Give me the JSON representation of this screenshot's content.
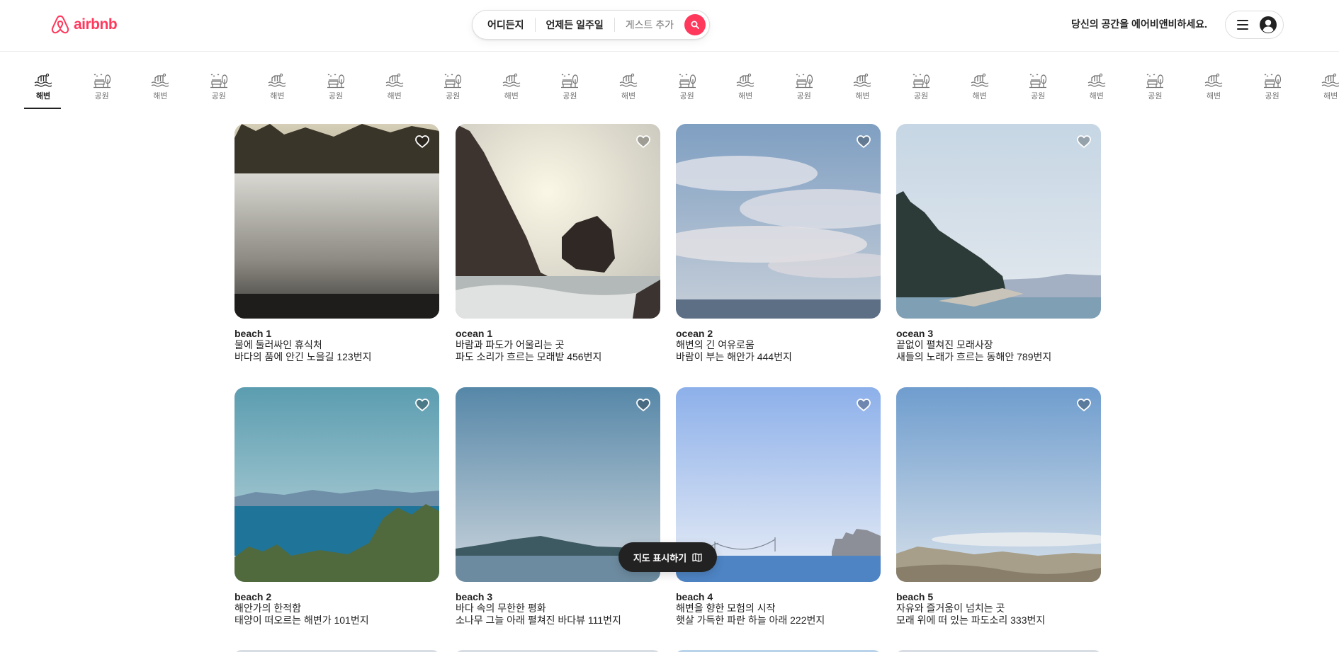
{
  "header": {
    "logo_text": "airbnb",
    "search": {
      "where": "어디든지",
      "when": "언제든 일주일",
      "guests": "게스트 추가"
    },
    "host_link": "당신의 공간을 에어비앤비하세요."
  },
  "categories": [
    {
      "label": "해변",
      "icon": "beach-icon",
      "active": true
    },
    {
      "label": "공원",
      "icon": "park-icon"
    },
    {
      "label": "해변",
      "icon": "beach-icon"
    },
    {
      "label": "공원",
      "icon": "park-icon"
    },
    {
      "label": "해변",
      "icon": "beach-icon"
    },
    {
      "label": "공원",
      "icon": "park-icon"
    },
    {
      "label": "해변",
      "icon": "beach-icon"
    },
    {
      "label": "공원",
      "icon": "park-icon"
    },
    {
      "label": "해변",
      "icon": "beach-icon"
    },
    {
      "label": "공원",
      "icon": "park-icon"
    },
    {
      "label": "해변",
      "icon": "beach-icon"
    },
    {
      "label": "공원",
      "icon": "park-icon"
    },
    {
      "label": "해변",
      "icon": "beach-icon"
    },
    {
      "label": "공원",
      "icon": "park-icon"
    },
    {
      "label": "해변",
      "icon": "beach-icon"
    },
    {
      "label": "공원",
      "icon": "park-icon"
    },
    {
      "label": "해변",
      "icon": "beach-icon"
    },
    {
      "label": "공원",
      "icon": "park-icon"
    },
    {
      "label": "해변",
      "icon": "beach-icon"
    },
    {
      "label": "공원",
      "icon": "park-icon"
    },
    {
      "label": "해변",
      "icon": "beach-icon"
    },
    {
      "label": "공원",
      "icon": "park-icon"
    },
    {
      "label": "해변",
      "icon": "beach-icon"
    }
  ],
  "listings": [
    {
      "title": "beach 1",
      "line1": "물에 둘러싸인 휴식처",
      "line2": "바다의 품에 안긴 노을길 123번지",
      "scene": "frost-field"
    },
    {
      "title": "ocean 1",
      "line1": "바람과 파도가 어울리는 곳",
      "line2": "파도 소리가 흐르는 모래밭 456번지",
      "scene": "rocky-coast"
    },
    {
      "title": "ocean 2",
      "line1": "해변의 긴 여유로움",
      "line2": "바람이 부는 해안가 444번지",
      "scene": "cloudy-sea"
    },
    {
      "title": "ocean 3",
      "line1": "끝없이 펼쳐진 모래사장",
      "line2": "새들의 노래가 흐르는 동해안 789번지",
      "scene": "tree-shore"
    },
    {
      "title": "beach 2",
      "line1": "해안가의 한적함",
      "line2": "태양이 떠오르는 해변가 101번지",
      "scene": "mountain-lake"
    },
    {
      "title": "beach 3",
      "line1": "바다 속의 무한한 평화",
      "line2": "소나무 그늘 아래 펼쳐진 바다뷰 111번지",
      "scene": "misty-bay"
    },
    {
      "title": "beach 4",
      "line1": "해변을 향한 모험의 시작",
      "line2": "햇살 가득한 파란 하늘 아래 222번지",
      "scene": "bridge-bay"
    },
    {
      "title": "beach 5",
      "line1": "자유와 즐거움이 넘치는 곳",
      "line2": "모래 위에 떠 있는 파도소리 333번지",
      "scene": "hills-bay"
    }
  ],
  "map_button": {
    "label": "지도 표시하기",
    "icon": "map-icon"
  },
  "colors": {
    "brand": "#FF385C",
    "text": "#222222",
    "muted": "#717171",
    "map_button_bg": "#222222"
  }
}
